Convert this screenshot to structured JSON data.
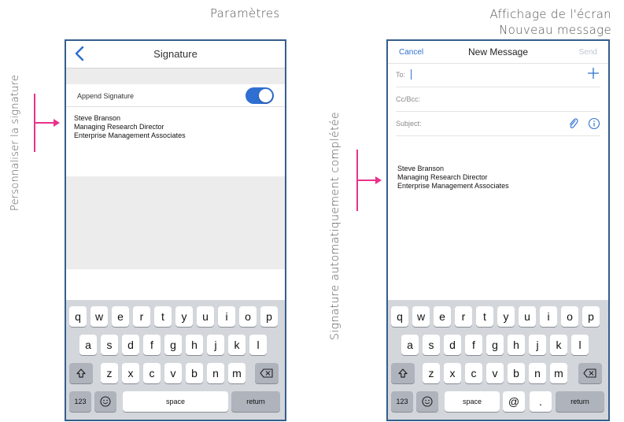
{
  "captions": {
    "settings": "Paramètres",
    "screen_line1": "Affichage de l'écran",
    "screen_line2": "Nouveau message",
    "left_side": "Personnaliser la signature",
    "right_side": "Signature automatiquement complétée"
  },
  "settings_screen": {
    "title": "Signature",
    "append_label": "Append Signature",
    "append_enabled": true,
    "signature": [
      "Steve Branson",
      "Managing Research Director",
      "Enterprise Management Associates"
    ]
  },
  "compose_screen": {
    "cancel": "Cancel",
    "title": "New Message",
    "send": "Send",
    "to_label": "To:",
    "cc_label": "Cc/Bcc:",
    "subject_label": "Subject:",
    "signature": [
      "Steve Branson",
      "Managing Research Director",
      "Enterprise Management Associates"
    ]
  },
  "keyboard": {
    "row1": [
      "q",
      "w",
      "e",
      "r",
      "t",
      "y",
      "u",
      "i",
      "o",
      "p"
    ],
    "row2": [
      "a",
      "s",
      "d",
      "f",
      "g",
      "h",
      "j",
      "k",
      "l"
    ],
    "row3": [
      "z",
      "x",
      "c",
      "v",
      "b",
      "n",
      "m"
    ],
    "numbers": "123",
    "space": "space",
    "return": "return",
    "at": "@",
    "dot": "."
  },
  "colors": {
    "accent": "#2f6fd1",
    "bracket": "#e8328b",
    "frame": "#355e8c"
  }
}
